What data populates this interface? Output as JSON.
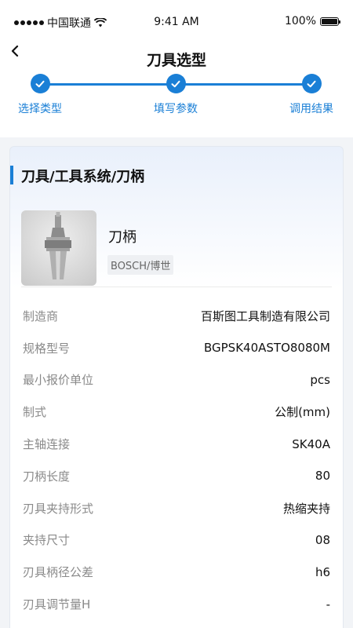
{
  "status": {
    "carrier": "中国联通",
    "time": "9:41 AM",
    "battery": "100%"
  },
  "nav": {
    "title": "刀具选型"
  },
  "steps": [
    {
      "label": "选择类型"
    },
    {
      "label": "填写参数"
    },
    {
      "label": "调用结果"
    }
  ],
  "card": {
    "title": "刀具/工具系统/刀柄"
  },
  "product": {
    "name": "刀柄",
    "brand": "BOSCH/博世"
  },
  "specs": [
    {
      "label": "制造商",
      "value": "百斯图工具制造有限公司"
    },
    {
      "label": "规格型号",
      "value": "BGPSK40ASTO8080M"
    },
    {
      "label": "最小报价单位",
      "value": "pcs"
    },
    {
      "label": "制式",
      "value": "公制(mm)"
    },
    {
      "label": "主轴连接",
      "value": "SK40A"
    },
    {
      "label": "刀柄长度",
      "value": "80"
    },
    {
      "label": "刃具夹持形式",
      "value": "热缩夹持"
    },
    {
      "label": "夹持尺寸",
      "value": "08"
    },
    {
      "label": "刃具柄径公差",
      "value": "h6"
    },
    {
      "label": "刃具调节量H",
      "value": "-"
    }
  ],
  "colors": {
    "accent": "#1a7fd6",
    "label_gray": "#8a8a8a"
  }
}
